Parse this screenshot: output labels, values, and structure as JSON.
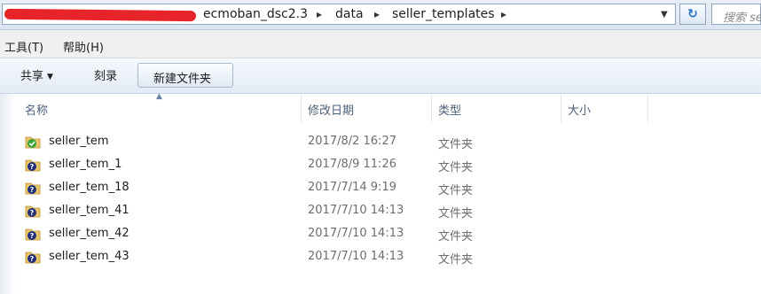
{
  "address_bar": {
    "crumbs": [
      "ecmoban_dsc2.3",
      "data",
      "seller_templates"
    ],
    "separator": "▸",
    "search_placeholder": "搜索 seller"
  },
  "menu": {
    "items": [
      "工具(T)",
      "帮助(H)"
    ]
  },
  "toolbar": {
    "share_label": "共享",
    "burn_label": "刻录",
    "new_folder_label": "新建文件夹"
  },
  "columns": {
    "name": "名称",
    "date": "修改日期",
    "type": "类型",
    "size": "大小"
  },
  "files": [
    {
      "name": "seller_tem",
      "date": "2017/8/2 16:27",
      "type": "文件夹",
      "icon": "folder-check-icon"
    },
    {
      "name": "seller_tem_1",
      "date": "2017/8/9 11:26",
      "type": "文件夹",
      "icon": "folder-question-icon"
    },
    {
      "name": "seller_tem_18",
      "date": "2017/7/14 9:19",
      "type": "文件夹",
      "icon": "folder-question-icon"
    },
    {
      "name": "seller_tem_41",
      "date": "2017/7/10 14:13",
      "type": "文件夹",
      "icon": "folder-question-icon"
    },
    {
      "name": "seller_tem_42",
      "date": "2017/7/10 14:13",
      "type": "文件夹",
      "icon": "folder-question-icon"
    },
    {
      "name": "seller_tem_43",
      "date": "2017/7/10 14:13",
      "type": "文件夹",
      "icon": "folder-question-icon"
    }
  ],
  "colors": {
    "accent": "#2a6fc9",
    "redaction": "#e8242b",
    "ok_badge": "#3aa63a",
    "question_badge": "#1f2f7a",
    "folder": "#e9c46a"
  }
}
